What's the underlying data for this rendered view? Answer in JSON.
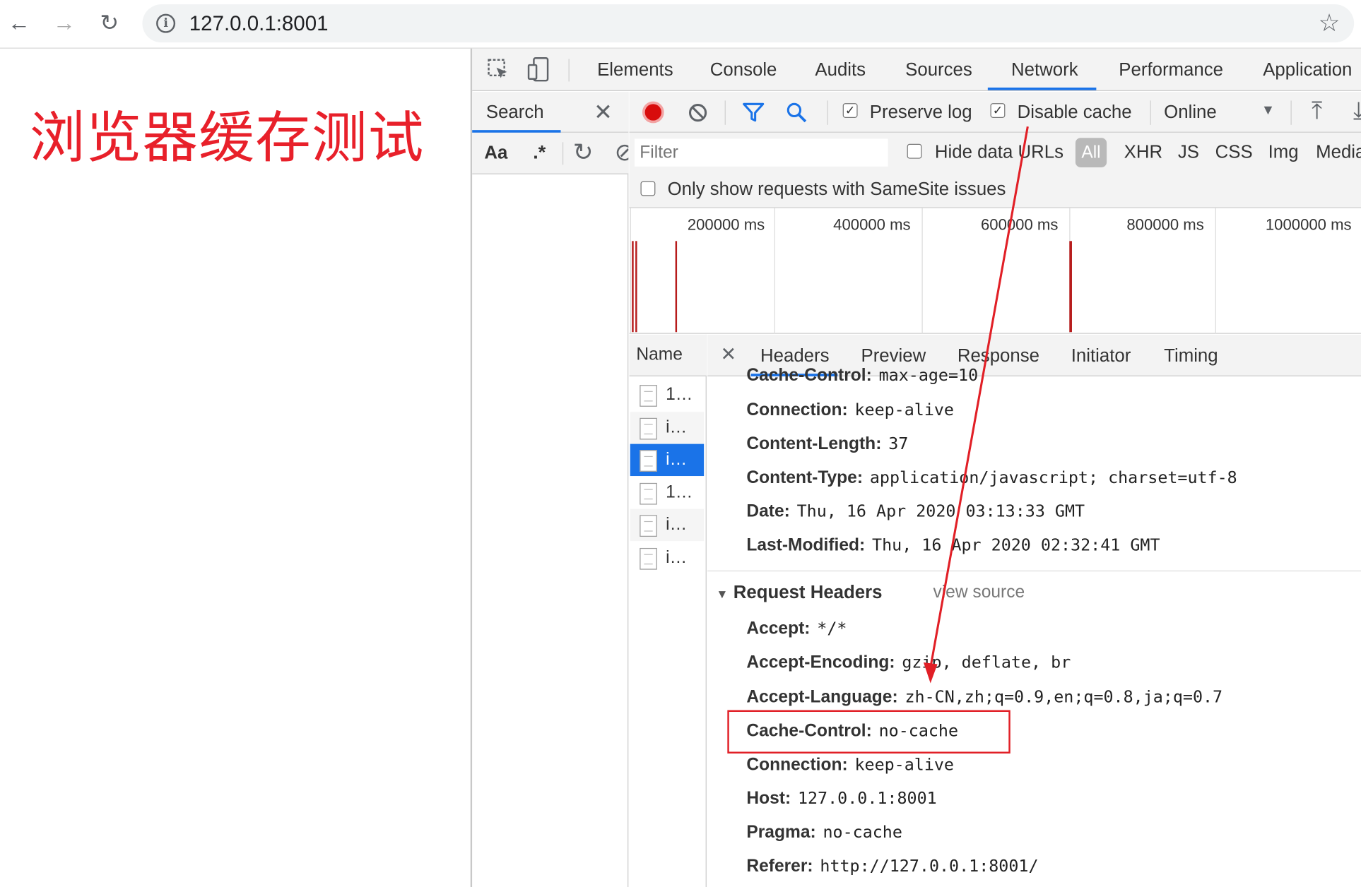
{
  "browser": {
    "back_icon": "←",
    "forward_icon": "→",
    "reload_icon": "↻",
    "url": "127.0.0.1:8001",
    "info_icon": "i",
    "star_icon": "☆"
  },
  "page": {
    "heading": "浏览器缓存测试"
  },
  "devtools": {
    "tabs": [
      "Elements",
      "Console",
      "Audits",
      "Sources",
      "Network",
      "Performance",
      "Application"
    ],
    "active_tab": "Network"
  },
  "search_panel": {
    "title": "Search",
    "close_icon": "✕",
    "case_label": "Aa",
    "regex_label": ".*",
    "refresh_icon": "↻",
    "clear_icon": "⊘"
  },
  "network_toolbar": {
    "preserve_log": {
      "label": "Preserve log",
      "checked": true
    },
    "disable_cache": {
      "label": "Disable cache",
      "checked": true
    },
    "throttle": "Online",
    "dropdown_icon": "▼",
    "import_icon": "⤒",
    "export_icon": "⤓"
  },
  "filter": {
    "placeholder": "Filter",
    "hide_data_urls": {
      "label": "Hide data URLs",
      "checked": false
    },
    "types": [
      "All",
      "XHR",
      "JS",
      "CSS",
      "Img",
      "Media"
    ],
    "samesite": {
      "label": "Only show requests with SameSite issues",
      "checked": false
    }
  },
  "timeline": {
    "ticks": [
      "200000 ms",
      "400000 ms",
      "600000 ms",
      "800000 ms",
      "1000000 ms"
    ]
  },
  "requests": {
    "header": "Name",
    "rows": [
      "1…",
      "i…",
      "i…",
      "1…",
      "i…",
      "i…"
    ],
    "selected_index": 2
  },
  "details": {
    "close_icon": "✕",
    "tabs": [
      "Headers",
      "Preview",
      "Response",
      "Initiator",
      "Timing"
    ],
    "active_tab": "Headers",
    "response_headers": [
      {
        "key": "Cache-Control:",
        "value": "max-age=10"
      },
      {
        "key": "Connection:",
        "value": "keep-alive"
      },
      {
        "key": "Content-Length:",
        "value": "37"
      },
      {
        "key": "Content-Type:",
        "value": "application/javascript; charset=utf-8"
      },
      {
        "key": "Date:",
        "value": "Thu, 16 Apr 2020 03:13:33 GMT"
      },
      {
        "key": "Last-Modified:",
        "value": "Thu, 16 Apr 2020 02:32:41 GMT"
      }
    ],
    "request_section": {
      "title": "Request Headers",
      "view_source": "view source",
      "headers": [
        {
          "key": "Accept:",
          "value": "*/*"
        },
        {
          "key": "Accept-Encoding:",
          "value": "gzip, deflate, br"
        },
        {
          "key": "Accept-Language:",
          "value": "zh-CN,zh;q=0.9,en;q=0.8,ja;q=0.7"
        },
        {
          "key": "Cache-Control:",
          "value": "no-cache"
        },
        {
          "key": "Connection:",
          "value": "keep-alive"
        },
        {
          "key": "Host:",
          "value": "127.0.0.1:8001"
        },
        {
          "key": "Pragma:",
          "value": "no-cache"
        },
        {
          "key": "Referer:",
          "value": "http://127.0.0.1:8001/"
        }
      ]
    }
  },
  "annotation": {
    "color": "#e11f26"
  }
}
